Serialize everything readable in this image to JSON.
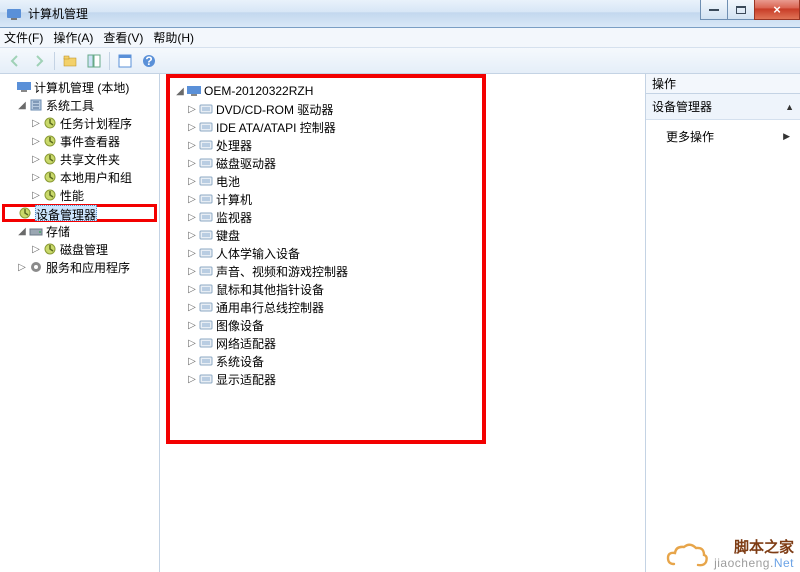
{
  "window": {
    "title": "计算机管理"
  },
  "menu": {
    "file": "文件(F)",
    "action": "操作(A)",
    "view": "查看(V)",
    "help": "帮助(H)"
  },
  "toolbar_icons": [
    "back",
    "forward",
    "up",
    "show-hide",
    "help",
    "properties",
    "refresh"
  ],
  "left_tree": {
    "root": "计算机管理 (本地)",
    "groups": [
      {
        "label": "系统工具",
        "expanded": true,
        "children": [
          {
            "label": "任务计划程序"
          },
          {
            "label": "事件查看器"
          },
          {
            "label": "共享文件夹"
          },
          {
            "label": "本地用户和组"
          },
          {
            "label": "性能"
          },
          {
            "label": "设备管理器",
            "selected": true
          }
        ]
      },
      {
        "label": "存储",
        "expanded": true,
        "children": [
          {
            "label": "磁盘管理"
          }
        ]
      },
      {
        "label": "服务和应用程序",
        "expanded": false,
        "children": []
      }
    ]
  },
  "device_tree": {
    "root": "OEM-20120322RZH",
    "categories": [
      "DVD/CD-ROM 驱动器",
      "IDE ATA/ATAPI 控制器",
      "处理器",
      "磁盘驱动器",
      "电池",
      "计算机",
      "监视器",
      "键盘",
      "人体学输入设备",
      "声音、视频和游戏控制器",
      "鼠标和其他指针设备",
      "通用串行总线控制器",
      "图像设备",
      "网络适配器",
      "系统设备",
      "显示适配器"
    ]
  },
  "actions": {
    "header": "操作",
    "section": "设备管理器",
    "more": "更多操作"
  },
  "watermark": {
    "main": "脚本之家",
    "sub_prefix": "jiaocheng.",
    "sub_suffix": "Net"
  }
}
